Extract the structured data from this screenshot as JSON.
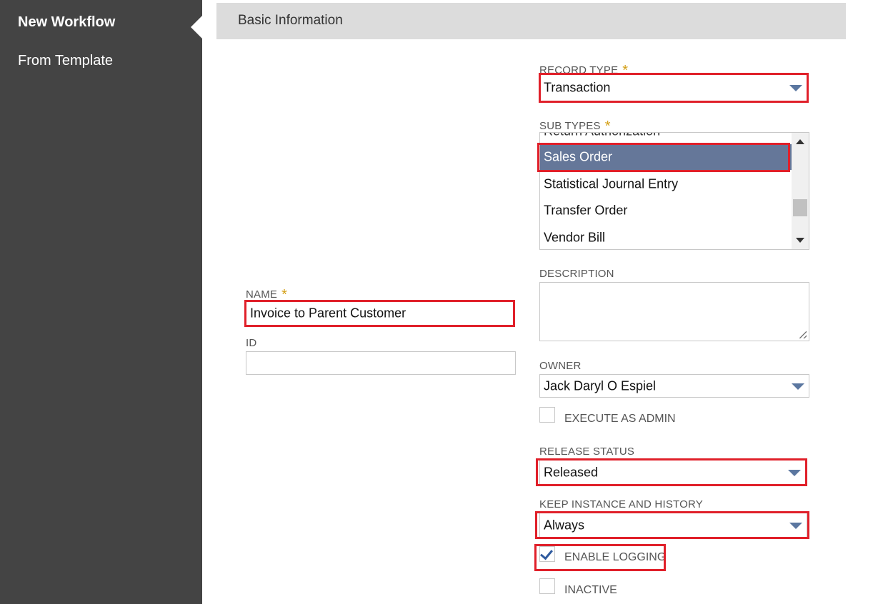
{
  "sidebar": {
    "items": [
      {
        "label": "New Workflow",
        "active": true
      },
      {
        "label": "From Template",
        "active": false
      }
    ]
  },
  "section": {
    "title": "Basic Information"
  },
  "form": {
    "record_type": {
      "label": "RECORD TYPE",
      "value": "Transaction",
      "required": "*"
    },
    "sub_types": {
      "label": "SUB TYPES",
      "required": "*",
      "items": [
        "Return Authorization",
        "Sales Order",
        "Statistical Journal Entry",
        "Transfer Order",
        "Vendor Bill"
      ],
      "selected": "Sales Order"
    },
    "name": {
      "label": "NAME",
      "value": "Invoice to Parent Customer",
      "required": "*"
    },
    "id": {
      "label": "ID",
      "value": ""
    },
    "description": {
      "label": "DESCRIPTION",
      "value": ""
    },
    "owner": {
      "label": "OWNER",
      "value": "Jack Daryl O Espiel"
    },
    "execute_as_admin": {
      "label": "EXECUTE AS ADMIN",
      "checked": false
    },
    "release_status": {
      "label": "RELEASE STATUS",
      "value": "Released"
    },
    "keep_instance": {
      "label": "KEEP INSTANCE AND HISTORY",
      "value": "Always"
    },
    "enable_logging": {
      "label": "ENABLE LOGGING",
      "checked": true
    },
    "inactive": {
      "label": "INACTIVE",
      "checked": false
    }
  },
  "colors": {
    "sidebar_bg": "#444444",
    "highlight": "#e0202a",
    "selected_row": "#657799",
    "caret": "#5b77a0",
    "required": "#d4a017"
  }
}
